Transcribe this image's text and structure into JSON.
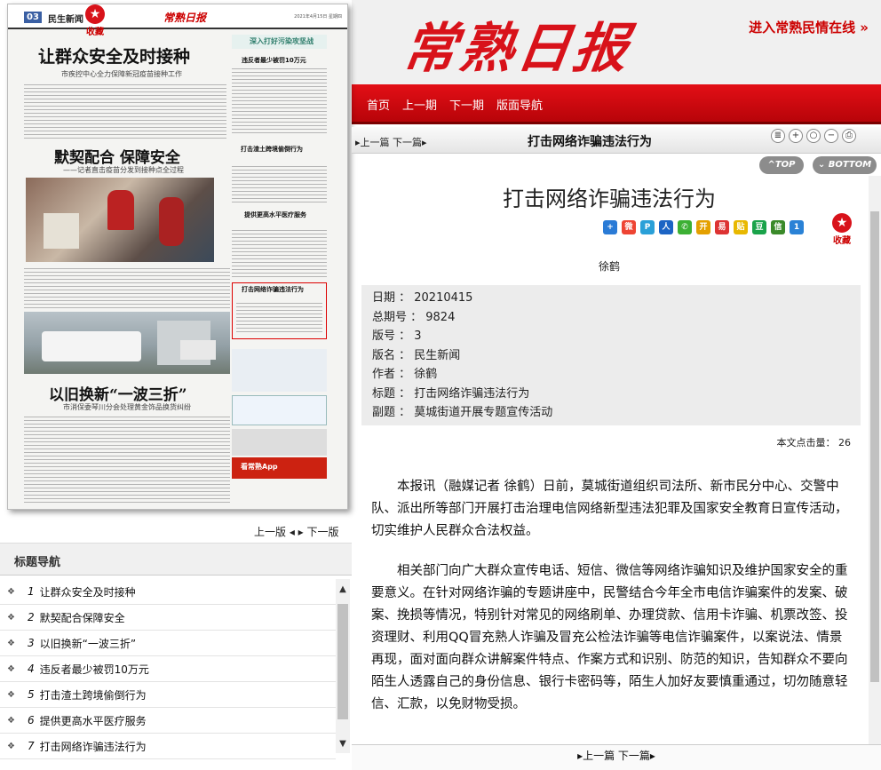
{
  "header": {
    "logo_text": "常熟日报",
    "top_link": "进入常熟民情在线 »",
    "nav": [
      "首页",
      "上一期",
      "下一期",
      "版面导航"
    ]
  },
  "paper": {
    "page_tag": "03",
    "section": "民生新闻",
    "logo": "常熟日报",
    "favorite_label": "收藏",
    "headline1": "让群众安全及时接种",
    "sub1": "市疾控中心全力保障新冠疫苗接种工作",
    "headline2": "默契配合 保障安全",
    "sub2": "——记者直击疫苗分发到接种点全过程",
    "headline3": "以旧换新“一波三折”",
    "sub3": "市消保委琴川分会处理黄金饰品换货纠纷",
    "r_banner": "深入打好污染攻坚战",
    "r_title1": "违反者最少被罚10万元",
    "r_title2": "打击渣土跨境偷倒行为",
    "r_title3": "提供更高水平医疗服务",
    "r_title4": "打击网络诈骗违法行为",
    "r_app": "看常熟App"
  },
  "left_pager": "上一版 ◂ ▸ 下一版",
  "nav_panel": {
    "title": "标题导航",
    "items": [
      {
        "num": "1",
        "label": "让群众安全及时接种"
      },
      {
        "num": "2",
        "label": "默契配合保障安全"
      },
      {
        "num": "3",
        "label": "以旧换新“一波三折”"
      },
      {
        "num": "4",
        "label": "违反者最少被罚10万元"
      },
      {
        "num": "5",
        "label": "打击渣土跨境偷倒行为"
      },
      {
        "num": "6",
        "label": "提供更高水平医疗服务"
      },
      {
        "num": "7",
        "label": "打击网络诈骗违法行为"
      }
    ]
  },
  "article_bar": {
    "prevnext": "▸上一篇 下一篇▸",
    "title": "打击网络诈骗违法行为"
  },
  "buttons": {
    "top": "^TOP",
    "bottom": "⌄ BOTTOM"
  },
  "article": {
    "title": "打击网络诈骗违法行为",
    "favorite_label": "收藏",
    "author": "徐鹤",
    "meta": {
      "date": "日期 ： 20210415",
      "issue": "总期号 ： 9824",
      "page": "版号 ： 3",
      "section": "版名 ： 民生新闻",
      "author": "作者 ： 徐鹤",
      "title": "标题 ： 打击网络诈骗违法行为",
      "subtitle": "副题 ： 莫城街道开展专题宣传活动"
    },
    "hits": "本文点击量：  26",
    "paragraphs": [
      "本报讯（融媒记者 徐鹤）日前，莫城街道组织司法所、新市民分中心、交警中队、派出所等部门开展打击治理电信网络新型违法犯罪及国家安全教育日宣传活动，切实维护人民群众合法权益。",
      "相关部门向广大群众宣传电话、短信、微信等网络诈骗知识及维护国家安全的重要意义。在针对网络诈骗的专题讲座中，民警结合今年全市电信诈骗案件的发案、破案、挽损等情况，特别针对常见的网络刷单、办理贷款、信用卡诈骗、机票改签、投资理财、利用QQ冒充熟人诈骗及冒充公检法诈骗等电信诈骗案件，以案说法、情景再现，面对面向群众讲解案件特点、作案方式和识别、防范的知识，告知群众不要向陌生人透露自己的身份信息、银行卡密码等，陌生人加好友要慎重通过，切勿随意轻信、汇款，以免财物受损。"
    ]
  },
  "bottom_pager": "▸上一篇 下一篇▸"
}
